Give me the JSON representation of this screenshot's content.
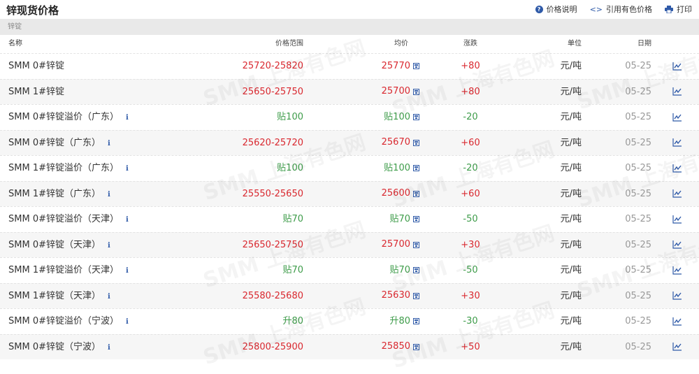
{
  "header": {
    "title": "锌现货价格",
    "links": [
      {
        "label": "价格说明",
        "icon": "question-circle-icon"
      },
      {
        "label": "引用有色价格",
        "icon": "code-icon"
      },
      {
        "label": "打印",
        "icon": "printer-icon"
      }
    ]
  },
  "section": {
    "label": "锌锭"
  },
  "columns": {
    "name": "名称",
    "range": "价格范围",
    "avg": "均价",
    "change": "涨跌",
    "unit": "单位",
    "date": "日期"
  },
  "rows": [
    {
      "name": "SMM 0#锌锭",
      "info": false,
      "range": "25720-25820",
      "avg": "25770",
      "change": "+80",
      "unit": "元/吨",
      "date": "05-25",
      "trend": "up"
    },
    {
      "name": "SMM 1#锌锭",
      "info": false,
      "range": "25650-25750",
      "avg": "25700",
      "change": "+80",
      "unit": "元/吨",
      "date": "05-25",
      "trend": "up"
    },
    {
      "name": "SMM 0#锌锭溢价（广东）",
      "info": true,
      "range": "贴100",
      "avg": "贴100",
      "change": "-20",
      "unit": "元/吨",
      "date": "05-25",
      "trend": "down"
    },
    {
      "name": "SMM 0#锌锭（广东）",
      "info": true,
      "range": "25620-25720",
      "avg": "25670",
      "change": "+60",
      "unit": "元/吨",
      "date": "05-25",
      "trend": "up"
    },
    {
      "name": "SMM 1#锌锭溢价（广东）",
      "info": true,
      "range": "贴100",
      "avg": "贴100",
      "change": "-20",
      "unit": "元/吨",
      "date": "05-25",
      "trend": "down"
    },
    {
      "name": "SMM 1#锌锭（广东）",
      "info": true,
      "range": "25550-25650",
      "avg": "25600",
      "change": "+60",
      "unit": "元/吨",
      "date": "05-25",
      "trend": "up"
    },
    {
      "name": "SMM 0#锌锭溢价（天津）",
      "info": true,
      "range": "贴70",
      "avg": "贴70",
      "change": "-50",
      "unit": "元/吨",
      "date": "05-25",
      "trend": "down"
    },
    {
      "name": "SMM 0#锌锭（天津）",
      "info": true,
      "range": "25650-25750",
      "avg": "25700",
      "change": "+30",
      "unit": "元/吨",
      "date": "05-25",
      "trend": "up"
    },
    {
      "name": "SMM 1#锌锭溢价（天津）",
      "info": true,
      "range": "贴70",
      "avg": "贴70",
      "change": "-50",
      "unit": "元/吨",
      "date": "05-25",
      "trend": "down"
    },
    {
      "name": "SMM 1#锌锭（天津）",
      "info": true,
      "range": "25580-25680",
      "avg": "25630",
      "change": "+30",
      "unit": "元/吨",
      "date": "05-25",
      "trend": "up"
    },
    {
      "name": "SMM 0#锌锭溢价（宁波）",
      "info": true,
      "range": "升80",
      "avg": "升80",
      "change": "-30",
      "unit": "元/吨",
      "date": "05-25",
      "trend": "down"
    },
    {
      "name": "SMM 0#锌锭（宁波）",
      "info": true,
      "range": "25800-25900",
      "avg": "25850",
      "change": "+50",
      "unit": "元/吨",
      "date": "05-25",
      "trend": "up"
    }
  ],
  "colors": {
    "up": "#d9282f",
    "down": "#3e9c4a",
    "accent": "#2f5aa8"
  },
  "watermark": "SMM 上海有色网"
}
